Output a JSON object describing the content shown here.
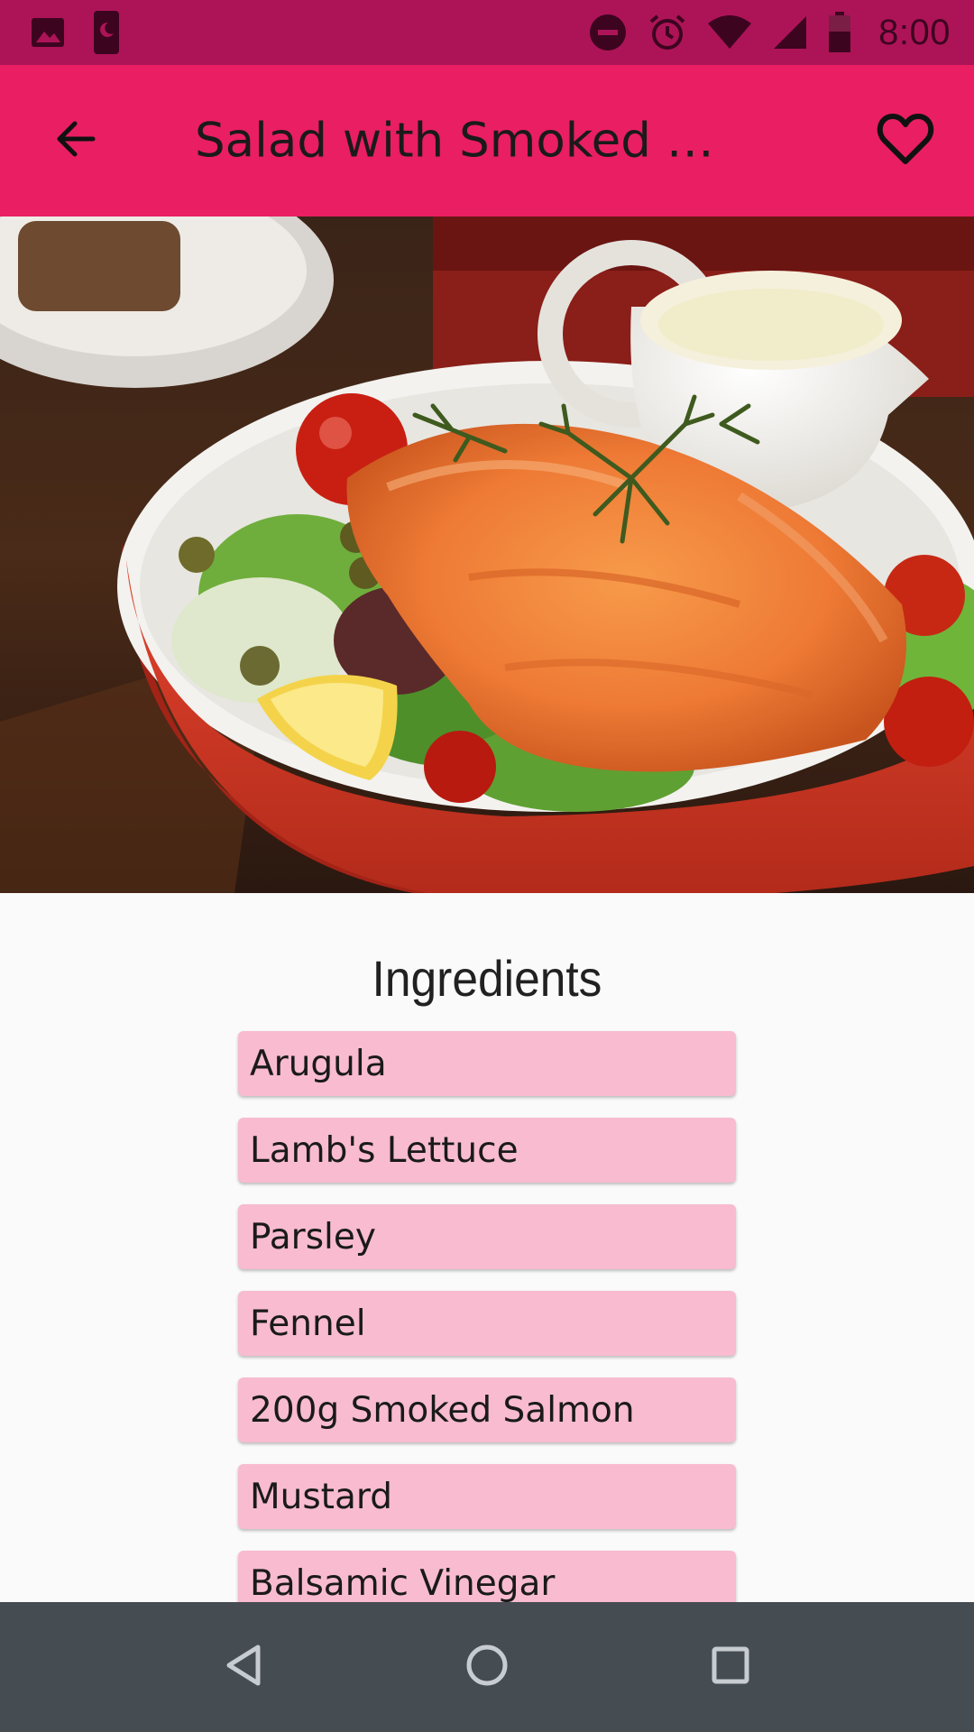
{
  "status_bar": {
    "time": "8:00",
    "icons_left": [
      "image-icon",
      "phone-moon-icon"
    ],
    "icons_right": [
      "do-not-disturb-icon",
      "alarm-icon",
      "wifi-icon",
      "signal-icon",
      "battery-icon"
    ]
  },
  "app_bar": {
    "title": "Salad with Smoked …",
    "back_icon": "arrow-back-icon",
    "favorite_icon": "heart-outline-icon",
    "color": "#e91e63"
  },
  "hero": {
    "icon": "salmon-salad-photo"
  },
  "ingredients": {
    "heading": "Ingredients",
    "items": [
      "Arugula",
      "Lamb's Lettuce",
      "Parsley",
      "Fennel",
      "200g Smoked Salmon",
      "Mustard",
      "Balsamic Vinegar"
    ],
    "item_color": "#f8bbd0"
  },
  "nav_bar": {
    "buttons": [
      "back-triangle-icon",
      "home-circle-icon",
      "recents-square-icon"
    ]
  }
}
